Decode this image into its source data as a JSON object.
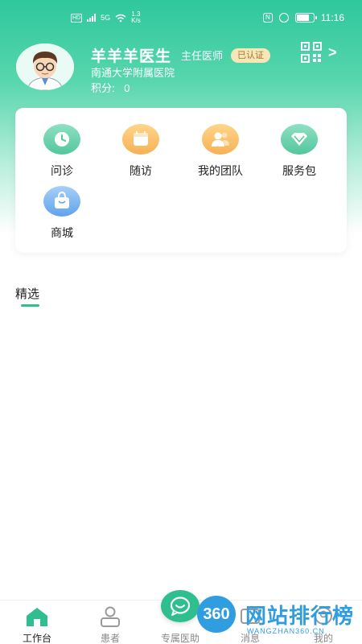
{
  "status_bar": {
    "network_badge": "HD",
    "signal_label": "5G",
    "speed_value": "1.3",
    "speed_unit": "K/s",
    "time": "11:16",
    "battery_percent": 77
  },
  "profile": {
    "name": "羊羊羊医生",
    "title": "主任医师",
    "badge": "已认证",
    "hospital": "南通大学附属医院",
    "points_label": "积分:",
    "points_value": "0",
    "chevron": ">"
  },
  "quick_actions": [
    {
      "label": "问诊",
      "icon": "clock-icon",
      "color": "green"
    },
    {
      "label": "随访",
      "icon": "calendar-icon",
      "color": "orange"
    },
    {
      "label": "我的团队",
      "icon": "team-icon",
      "color": "orange"
    },
    {
      "label": "服务包",
      "icon": "diamond-icon",
      "color": "green"
    },
    {
      "label": "商城",
      "icon": "shopping-bag-icon",
      "color": "blue"
    }
  ],
  "section": {
    "title": "精选"
  },
  "bottom_nav": {
    "items": [
      {
        "label": "工作台",
        "icon": "home-icon",
        "active": true
      },
      {
        "label": "患者",
        "icon": "patient-icon",
        "active": false
      },
      {
        "label": "专属医助",
        "icon": "chat-icon",
        "active": false
      },
      {
        "label": "消息",
        "icon": "message-icon",
        "active": false
      },
      {
        "label": "我的",
        "icon": "user-icon",
        "active": false
      }
    ]
  },
  "watermark": {
    "logo": "360",
    "text": "网站排行榜",
    "sub": "WANGZHAN360.CN"
  },
  "colors": {
    "primary": "#2fbf8f",
    "header_top": "#2fc79c",
    "badge_bg": "#f7e6b8",
    "badge_text": "#a5772a"
  }
}
